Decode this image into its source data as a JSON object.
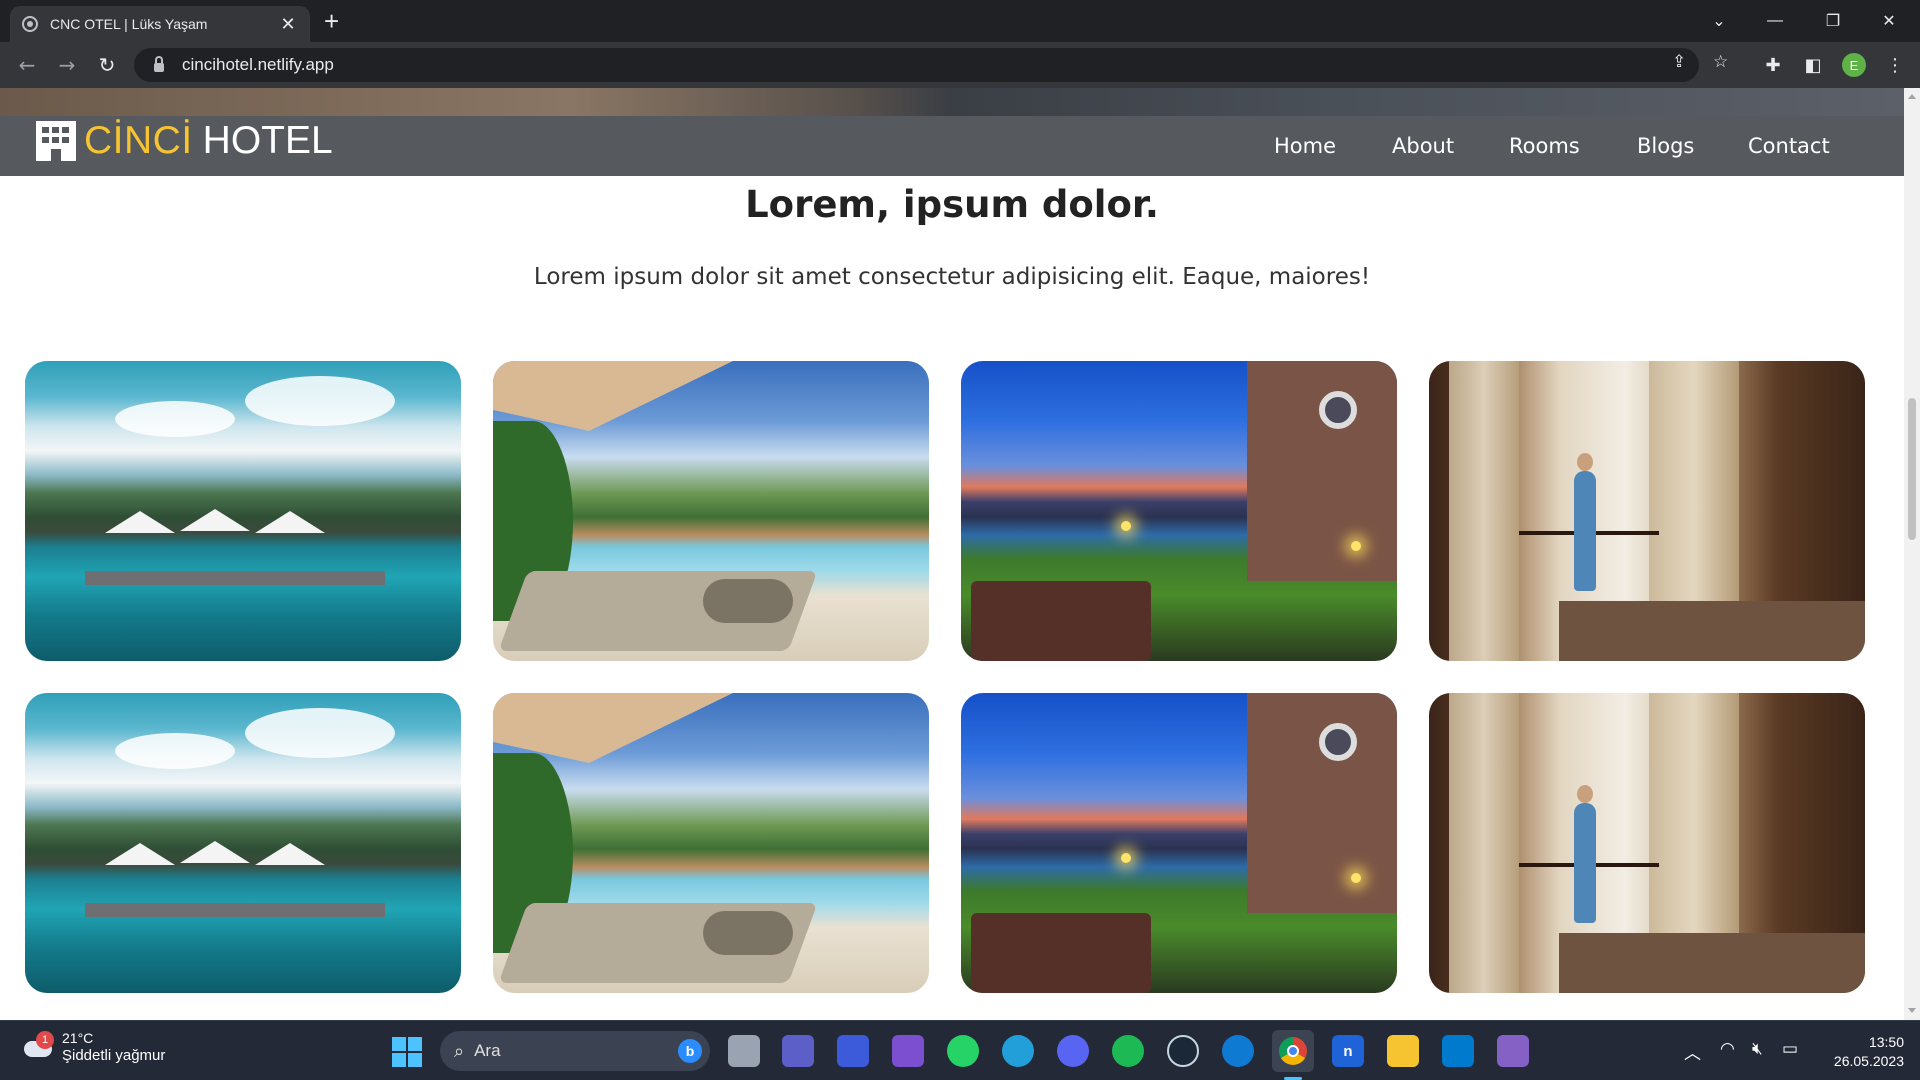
{
  "browser": {
    "tab_title": "CNC OTEL | Lüks Yaşam",
    "url": "cincihotel.netlify.app",
    "profile_initial": "E"
  },
  "site": {
    "brand_first": "CİNCİ",
    "brand_second": "HOTEL",
    "nav": [
      "Home",
      "About",
      "Rooms",
      "Blogs",
      "Contact"
    ],
    "heading": "Lorem, ipsum dolor.",
    "lead": "Lorem ipsum dolor sit amet consectetur adipisicing elit. Eaque, maiores!",
    "gallery": [
      {
        "image": "pool-with-umbrellas"
      },
      {
        "image": "tropical-pool-lounger"
      },
      {
        "image": "sunset-terrace-pool"
      },
      {
        "image": "canopy-bedroom-balcony"
      },
      {
        "image": "pool-with-umbrellas"
      },
      {
        "image": "tropical-pool-lounger"
      },
      {
        "image": "sunset-terrace-pool"
      },
      {
        "image": "canopy-bedroom-balcony"
      }
    ],
    "colors": {
      "header_bg": "#56595e",
      "brand_accent": "#f6c431"
    }
  },
  "taskbar": {
    "weather_badge": "1",
    "temperature": "21°C",
    "condition": "Şiddetli yağmur",
    "search_placeholder": "Ara",
    "time": "13:50",
    "date": "26.05.2023"
  }
}
